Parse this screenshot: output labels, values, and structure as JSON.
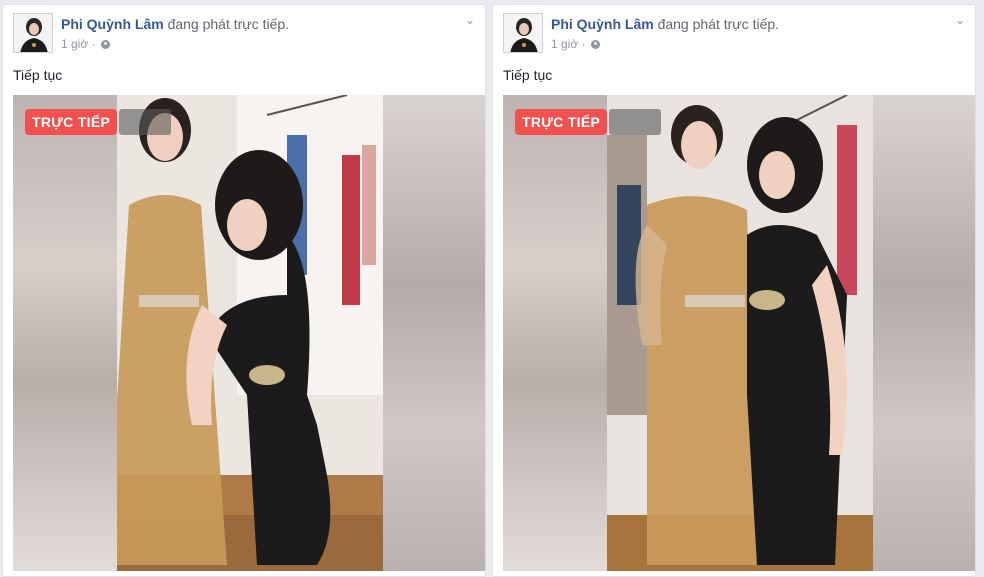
{
  "posts": [
    {
      "author": "Phi Quỳnh Lâm",
      "action": "đang phát trực tiếp.",
      "time": "1 giờ",
      "separator": "·",
      "text": "Tiếp tục",
      "live_label": "TRỰC TIẾP",
      "icons": {
        "privacy": "globe-icon",
        "menu": "chevron-down-icon"
      }
    },
    {
      "author": "Phi Quỳnh Lâm",
      "action": "đang phát trực tiếp.",
      "time": "1 giờ",
      "separator": "·",
      "text": "Tiếp tục",
      "live_label": "TRỰC TIẾP",
      "icons": {
        "privacy": "globe-icon",
        "menu": "chevron-down-icon"
      }
    }
  ],
  "colors": {
    "author_link": "#365899",
    "live_badge": "#f0514f",
    "background": "#e9ebee"
  }
}
